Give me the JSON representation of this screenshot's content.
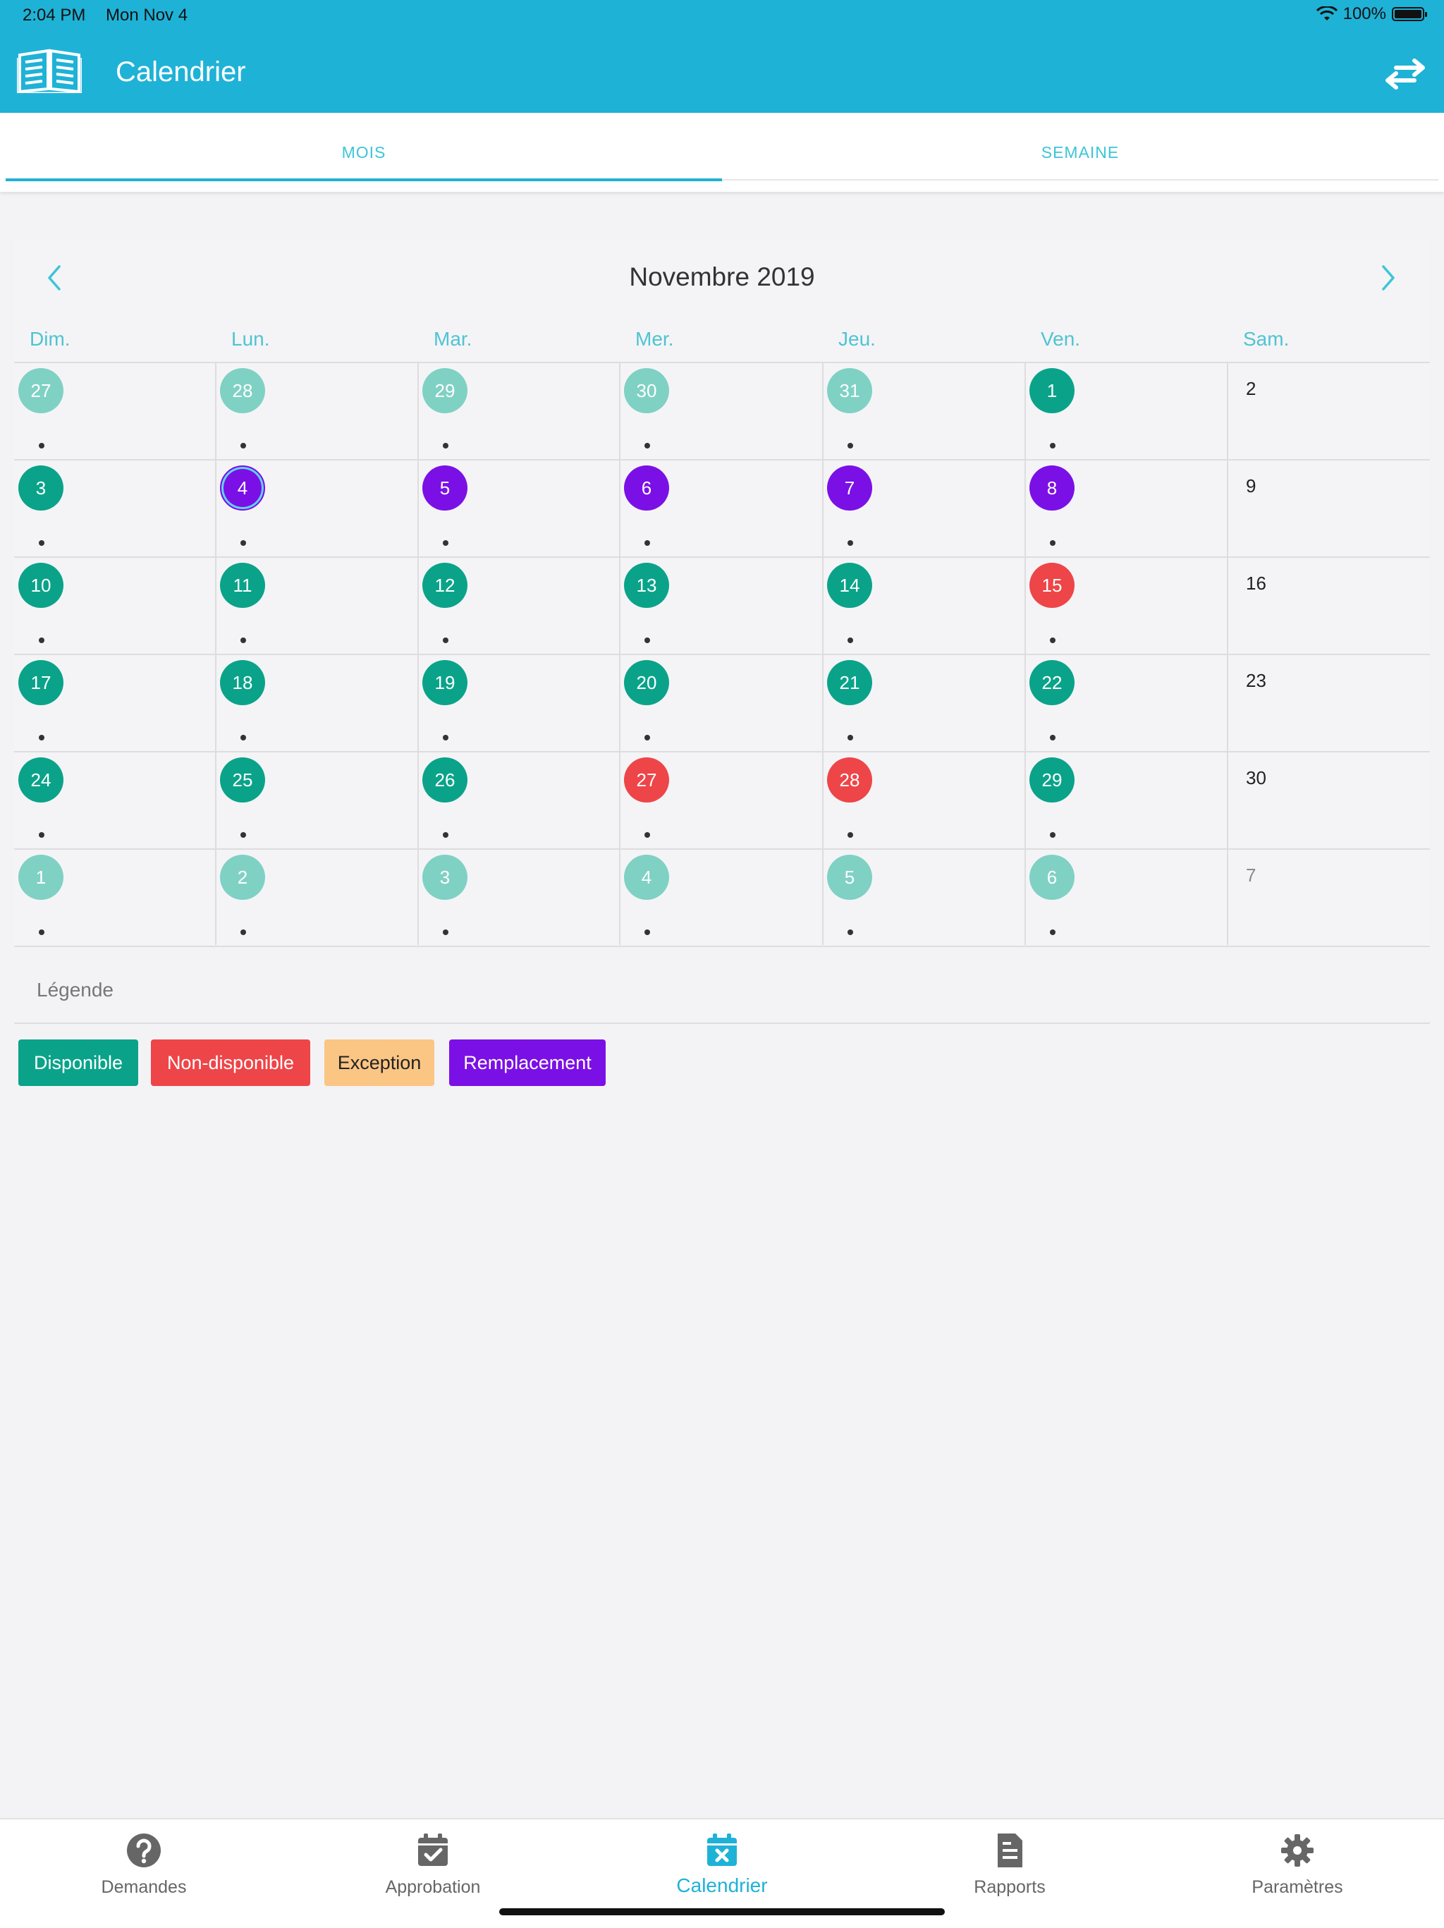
{
  "status_bar": {
    "time": "2:04 PM",
    "date": "Mon Nov 4",
    "battery": "100%"
  },
  "header": {
    "title": "Calendrier"
  },
  "tabs": [
    {
      "label": "MOIS",
      "active": true
    },
    {
      "label": "SEMAINE",
      "active": false
    }
  ],
  "calendar": {
    "month_title": "Novembre 2019",
    "weekdays": [
      "Dim.",
      "Lun.",
      "Mar.",
      "Mer.",
      "Jeu.",
      "Ven.",
      "Sam."
    ],
    "weeks": [
      [
        {
          "day": "27",
          "status": "faded",
          "dot": true
        },
        {
          "day": "28",
          "status": "faded",
          "dot": true
        },
        {
          "day": "29",
          "status": "faded",
          "dot": true
        },
        {
          "day": "30",
          "status": "faded",
          "dot": true
        },
        {
          "day": "31",
          "status": "faded",
          "dot": true
        },
        {
          "day": "1",
          "status": "disponible",
          "dot": true
        },
        {
          "day": "2",
          "status": "none",
          "dot": false
        }
      ],
      [
        {
          "day": "3",
          "status": "disponible",
          "dot": true
        },
        {
          "day": "4",
          "status": "remplacement",
          "dot": true,
          "today": true
        },
        {
          "day": "5",
          "status": "remplacement",
          "dot": true
        },
        {
          "day": "6",
          "status": "remplacement",
          "dot": true
        },
        {
          "day": "7",
          "status": "remplacement",
          "dot": true
        },
        {
          "day": "8",
          "status": "remplacement",
          "dot": true
        },
        {
          "day": "9",
          "status": "none",
          "dot": false
        }
      ],
      [
        {
          "day": "10",
          "status": "disponible",
          "dot": true
        },
        {
          "day": "11",
          "status": "disponible",
          "dot": true
        },
        {
          "day": "12",
          "status": "disponible",
          "dot": true
        },
        {
          "day": "13",
          "status": "disponible",
          "dot": true
        },
        {
          "day": "14",
          "status": "disponible",
          "dot": true
        },
        {
          "day": "15",
          "status": "non-disponible",
          "dot": true
        },
        {
          "day": "16",
          "status": "none",
          "dot": false
        }
      ],
      [
        {
          "day": "17",
          "status": "disponible",
          "dot": true
        },
        {
          "day": "18",
          "status": "disponible",
          "dot": true
        },
        {
          "day": "19",
          "status": "disponible",
          "dot": true
        },
        {
          "day": "20",
          "status": "disponible",
          "dot": true
        },
        {
          "day": "21",
          "status": "disponible",
          "dot": true
        },
        {
          "day": "22",
          "status": "disponible",
          "dot": true
        },
        {
          "day": "23",
          "status": "none",
          "dot": false
        }
      ],
      [
        {
          "day": "24",
          "status": "disponible",
          "dot": true
        },
        {
          "day": "25",
          "status": "disponible",
          "dot": true
        },
        {
          "day": "26",
          "status": "disponible",
          "dot": true
        },
        {
          "day": "27",
          "status": "non-disponible",
          "dot": true
        },
        {
          "day": "28",
          "status": "non-disponible",
          "dot": true
        },
        {
          "day": "29",
          "status": "disponible",
          "dot": true
        },
        {
          "day": "30",
          "status": "none",
          "dot": false
        }
      ],
      [
        {
          "day": "1",
          "status": "faded",
          "dot": true
        },
        {
          "day": "2",
          "status": "faded",
          "dot": true
        },
        {
          "day": "3",
          "status": "faded",
          "dot": true
        },
        {
          "day": "4",
          "status": "faded",
          "dot": true
        },
        {
          "day": "5",
          "status": "faded",
          "dot": true
        },
        {
          "day": "6",
          "status": "faded",
          "dot": true
        },
        {
          "day": "7",
          "status": "muted",
          "dot": false
        }
      ]
    ]
  },
  "legend": {
    "title": "Légende",
    "items": [
      {
        "label": "Disponible",
        "color": "#0aa38a",
        "text_color": "#ffffff"
      },
      {
        "label": "Non-disponible",
        "color": "#ee4548",
        "text_color": "#ffffff"
      },
      {
        "label": "Exception",
        "color": "#fbc584",
        "text_color": "#222222"
      },
      {
        "label": "Remplacement",
        "color": "#7b10e6",
        "text_color": "#ffffff"
      }
    ]
  },
  "colors": {
    "header": "#1fb2d7",
    "disponible": "#0aa38a",
    "non_disponible": "#ee4548",
    "remplacement": "#7b10e6",
    "faded": "#7fd1c4"
  },
  "tabbar": [
    {
      "label": "Demandes",
      "icon": "question-circle-icon",
      "active": false
    },
    {
      "label": "Approbation",
      "icon": "calendar-check-icon",
      "active": false
    },
    {
      "label": "Calendrier",
      "icon": "calendar-x-icon",
      "active": true
    },
    {
      "label": "Rapports",
      "icon": "document-icon",
      "active": false
    },
    {
      "label": "Paramètres",
      "icon": "gear-icon",
      "active": false
    }
  ]
}
